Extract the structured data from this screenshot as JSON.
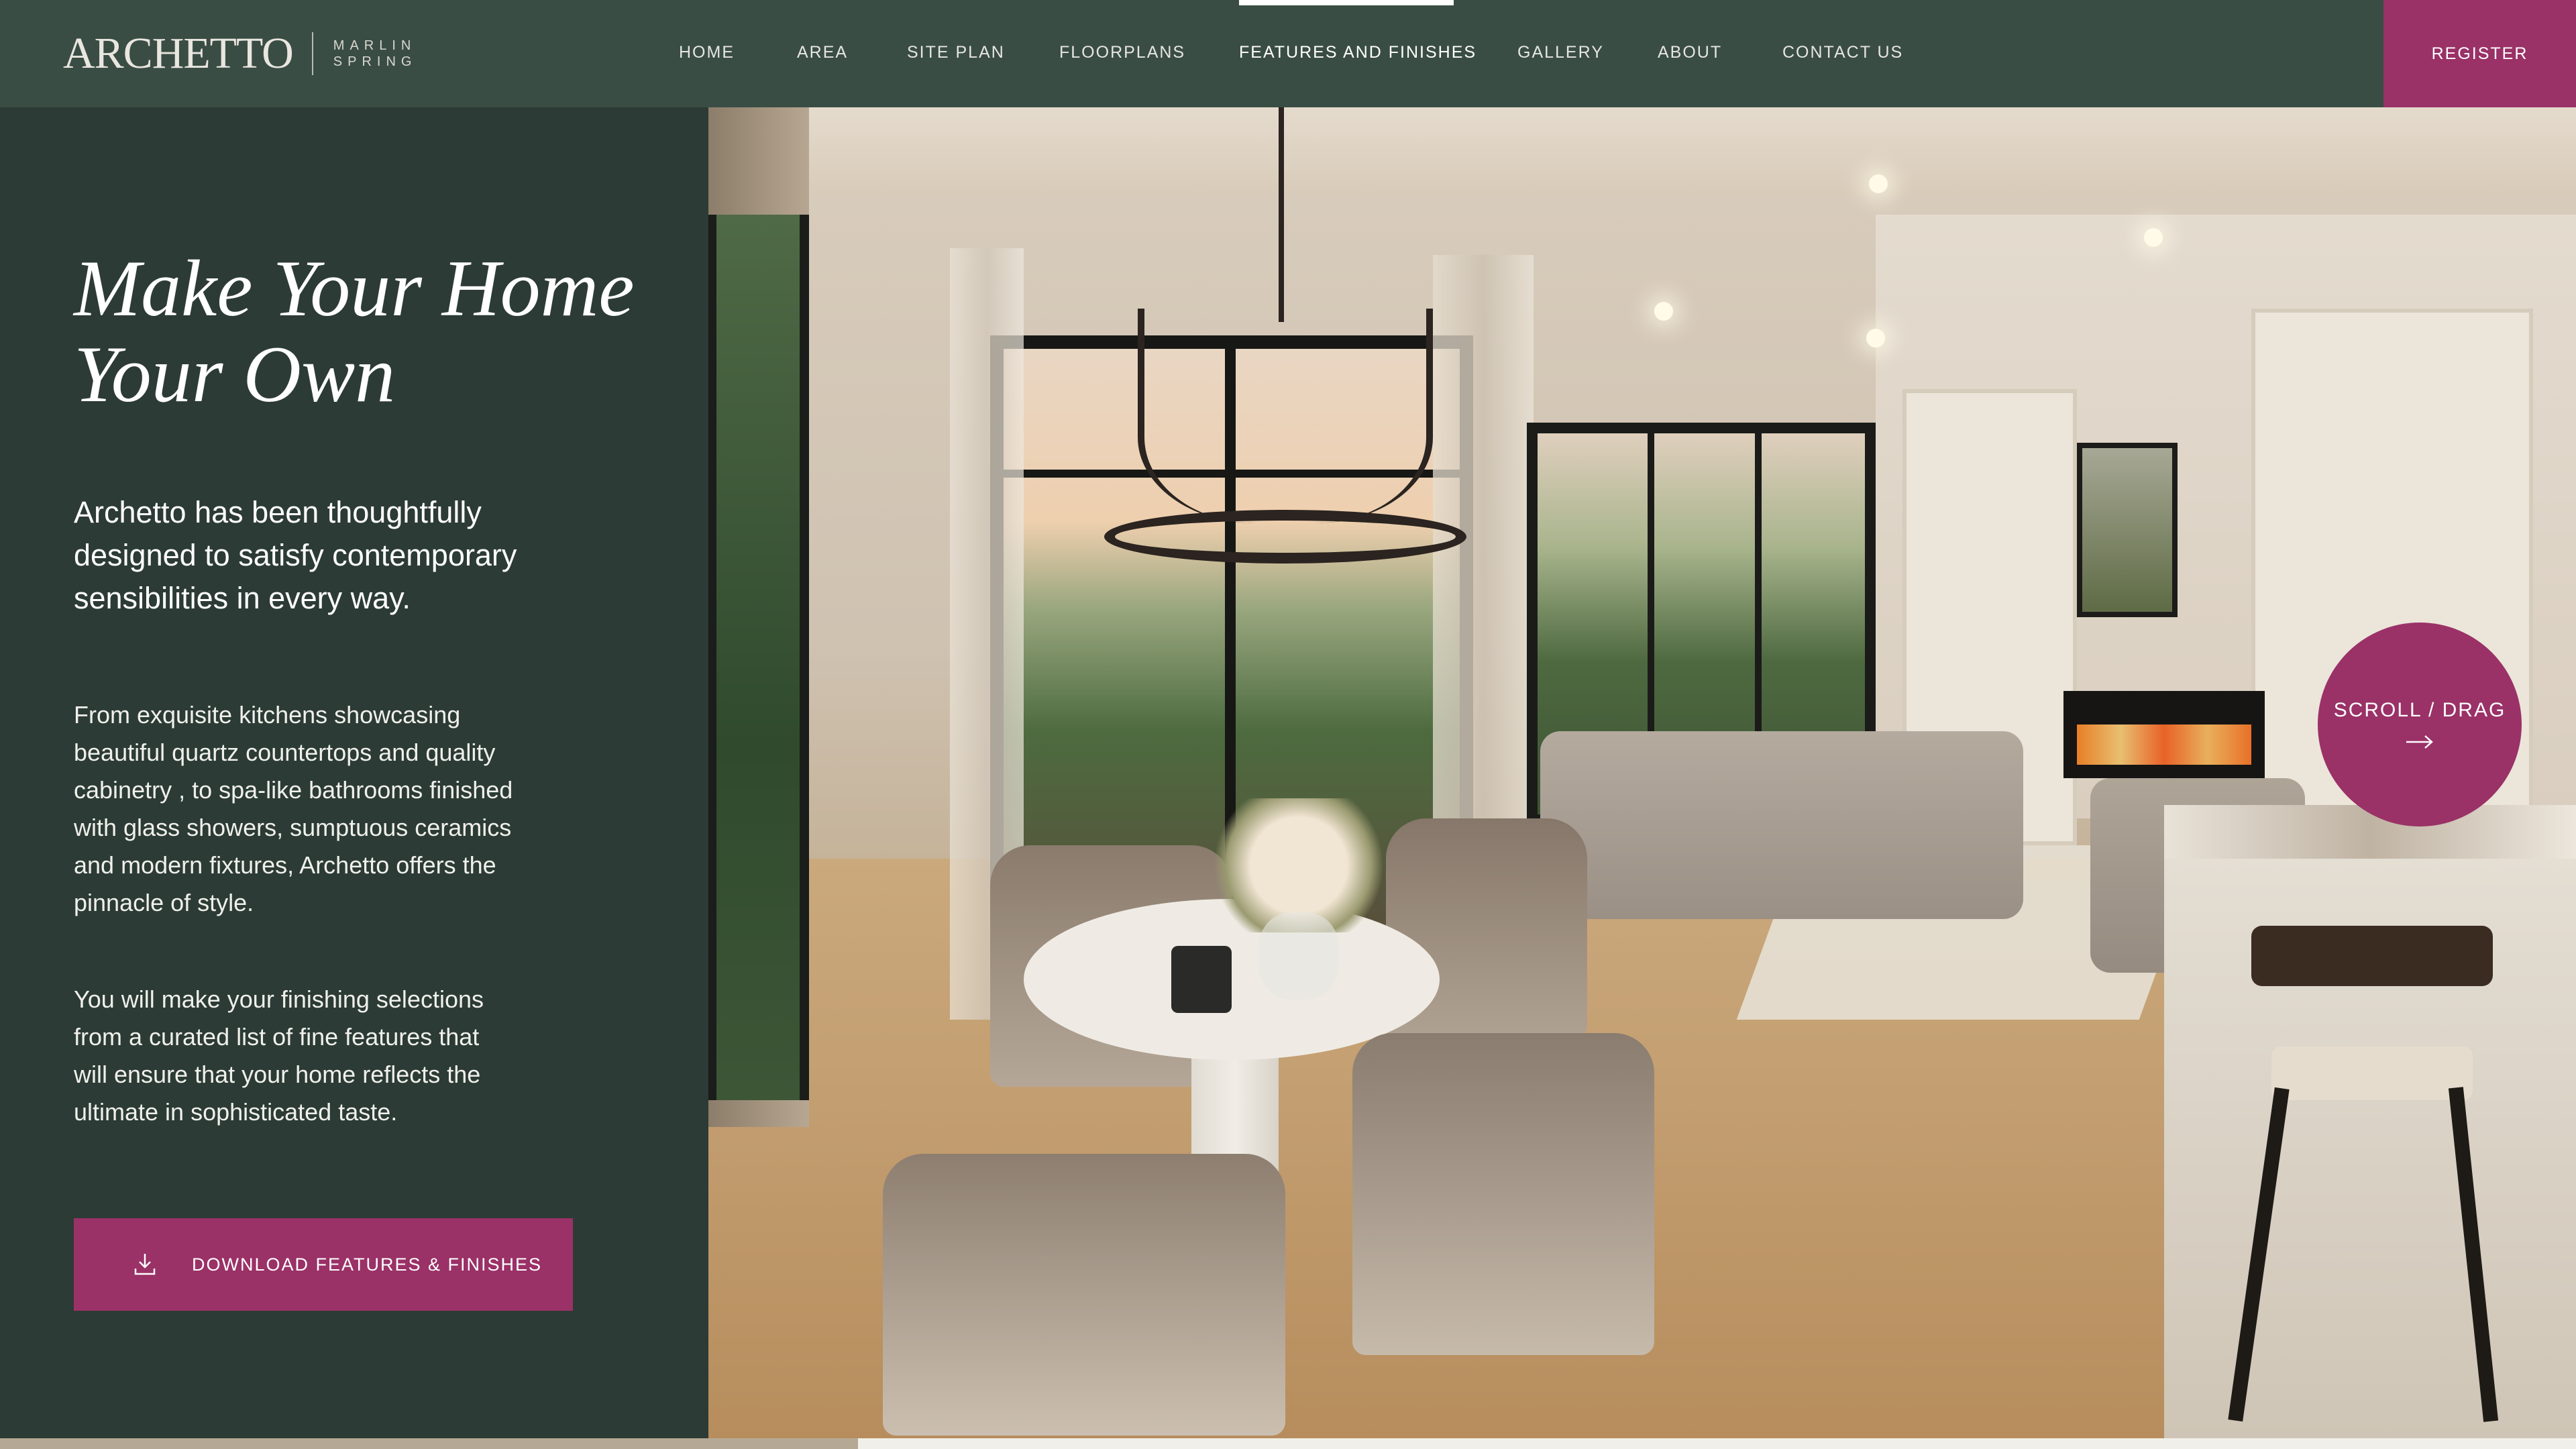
{
  "header": {
    "logo_main": "ARCHETTO",
    "logo_sub_line1": "MARLIN",
    "logo_sub_line2": "SPRING",
    "nav": [
      {
        "label": "HOME"
      },
      {
        "label": "AREA"
      },
      {
        "label": "SITE PLAN"
      },
      {
        "label": "FLOORPLANS"
      },
      {
        "label": "FEATURES AND FINISHES",
        "active": true
      },
      {
        "label": "GALLERY"
      },
      {
        "label": "ABOUT"
      },
      {
        "label": "CONTACT US"
      }
    ],
    "register_label": "REGISTER"
  },
  "intro": {
    "headline_line1": "Make Your Home",
    "headline_line2": "Your Own",
    "lead": "Archetto has been thoughtfully designed to satisfy contemporary sensibilities in every way.",
    "paragraph1": "From exquisite kitchens showcasing beautiful quartz countertops and quality cabinetry , to spa-like bathrooms finished with glass showers, sumptuous ceramics and modern fixtures, Archetto offers the pinnacle of style.",
    "paragraph2": "You will make your finishing selections from a curated list of fine features that will ensure that your home reflects the ultimate in sophisticated taste.",
    "download_label": "DOWNLOAD FEATURES & FINISHES",
    "download_icon": "download-icon"
  },
  "hero": {
    "scroll_label": "SCROLL / DRAG",
    "scroll_icon": "arrow-right-icon"
  },
  "progress": {
    "fraction": 0.333
  },
  "colors": {
    "brand_green": "#3a4d45",
    "panel_green": "#2c3b35",
    "accent_magenta": "#9a3167"
  }
}
